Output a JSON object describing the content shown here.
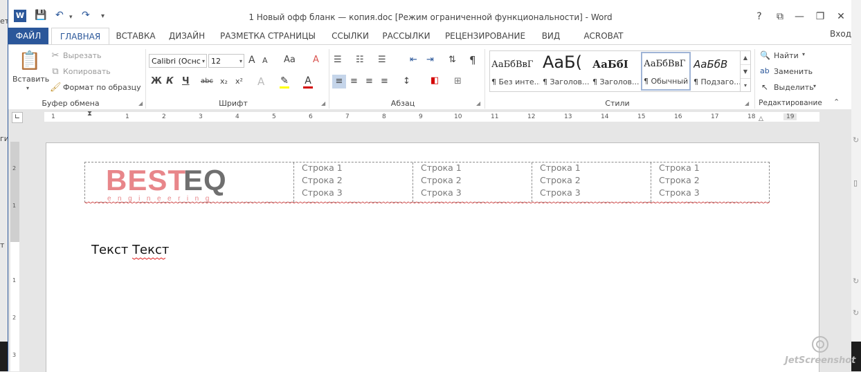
{
  "window_title": "1 Новый офф бланк — копия.doc [Режим ограниченной функциональности] - Word",
  "titlebar": {
    "help": "?",
    "minimize": "—",
    "restore": "❐",
    "close": "✕",
    "options": "⧉"
  },
  "tabs": {
    "file": "ФАЙЛ",
    "home": "ГЛАВНАЯ",
    "insert": "ВСТАВКА",
    "design": "ДИЗАЙН",
    "layout": "РАЗМЕТКА СТРАНИЦЫ",
    "references": "ССЫЛКИ",
    "mailings": "РАССЫЛКИ",
    "review": "РЕЦЕНЗИРОВАНИЕ",
    "view": "ВИД",
    "acrobat": "ACROBAT",
    "signin": "Вход"
  },
  "clipboard": {
    "paste": "Вставить",
    "cut": "Вырезать",
    "copy": "Копировать",
    "format_painter": "Формат по образцу",
    "label": "Буфер обмена"
  },
  "font": {
    "name": "Calibri (Оснс",
    "size": "12",
    "bold": "Ж",
    "italic": "К",
    "underline": "Ч",
    "strike": "abc",
    "sub": "x₂",
    "sup": "x²",
    "label": "Шрифт",
    "grow": "A",
    "shrink": "A",
    "case": "Aa",
    "clear": "A"
  },
  "paragraph": {
    "label": "Абзац",
    "pilcrow": "¶"
  },
  "styles": {
    "label": "Стили",
    "items": [
      {
        "preview": "АаБбВвГ",
        "name": "¶ Без инте..."
      },
      {
        "preview": "АаБ(",
        "name": "¶ Заголов..."
      },
      {
        "preview": "АаБбI",
        "name": "¶ Заголов..."
      },
      {
        "preview": "АаБбВвГ",
        "name": "¶ Обычный"
      },
      {
        "preview": "АаБбВ",
        "name": "¶ Подзаго..."
      }
    ]
  },
  "editing": {
    "find": "Найти",
    "replace": "Заменить",
    "select": "Выделить",
    "label": "Редактирование"
  },
  "ruler": {
    "ticks": [
      "1",
      "1",
      "2",
      "3",
      "4",
      "5",
      "6",
      "7",
      "8",
      "9",
      "10",
      "11",
      "12",
      "13",
      "14",
      "15",
      "16",
      "17",
      "18",
      "19"
    ]
  },
  "document": {
    "logo_word": "BESTEQ",
    "logo_sub": "engineering",
    "header_columns": [
      [
        "Строка 1",
        "Строка 2",
        "Строка 3"
      ],
      [
        "Строка 1",
        "Строка 2",
        "Строка 3"
      ],
      [
        "Строка 1",
        "Строка 2",
        "Строка 3"
      ],
      [
        "Строка 1",
        "Строка 2",
        "Строка 3"
      ]
    ],
    "body_word1": "Текст",
    "body_word2": "Текст"
  },
  "left_fragments": {
    "a": "ет",
    "b": "ги",
    "c": "т"
  },
  "watermark": "JetScreenshot",
  "colors": {
    "brand": "#2b579a",
    "logo_red": "#e8868a",
    "logo_gray": "#6f6f6f"
  }
}
